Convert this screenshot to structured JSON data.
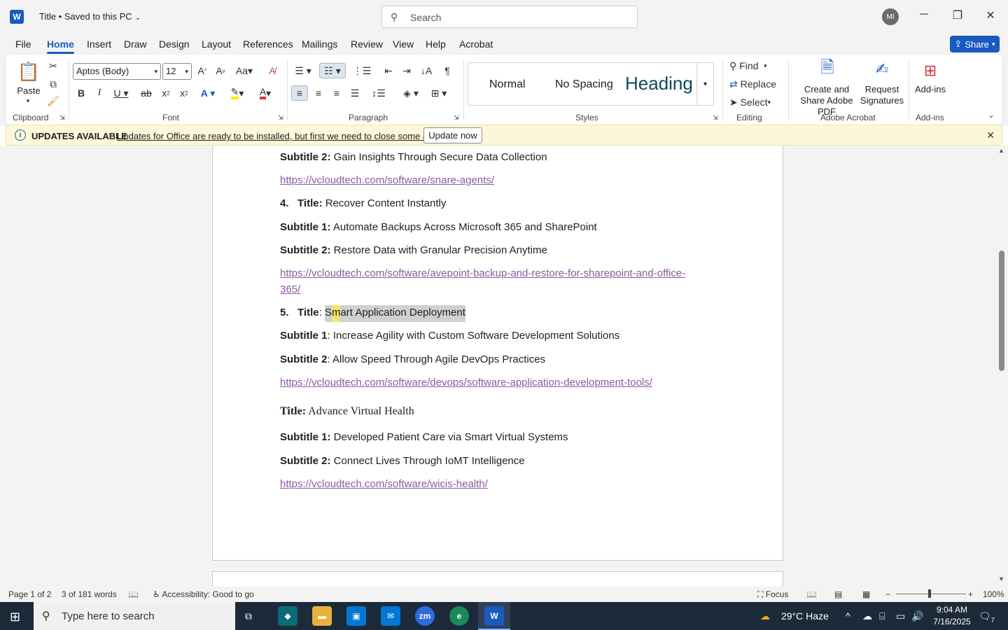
{
  "titlebar": {
    "title": "Title • Saved to this PC",
    "search_placeholder": "Search",
    "avatar_initials": "MI"
  },
  "menu": {
    "tabs": [
      "File",
      "Home",
      "Insert",
      "Draw",
      "Design",
      "Layout",
      "References",
      "Mailings",
      "Review",
      "View",
      "Help",
      "Acrobat"
    ],
    "active": "Home",
    "share_label": "Share"
  },
  "ribbon": {
    "clipboard": {
      "paste_label": "Paste",
      "group_label": "Clipboard"
    },
    "font": {
      "family": "Aptos (Body)",
      "size": "12",
      "group_label": "Font"
    },
    "paragraph": {
      "group_label": "Paragraph"
    },
    "styles": {
      "items": [
        "Normal",
        "No Spacing",
        "Heading"
      ],
      "group_label": "Styles"
    },
    "editing": {
      "find": "Find",
      "replace": "Replace",
      "select": "Select",
      "group_label": "Editing"
    },
    "acrobat": {
      "create_share": "Create and Share Adobe PDF",
      "request_sig": "Request Signatures",
      "group_label": "Adobe Acrobat"
    },
    "addins": {
      "label": "Add-ins",
      "group_label": "Add-ins"
    }
  },
  "update_bar": {
    "title": "UPDATES AVAILABLE",
    "message": "Updates for Office are ready to be installed, but first we need to close some apps.",
    "button": "Update now"
  },
  "document": {
    "lines": {
      "l1_label": "Subtitle 2:",
      "l1_text": " Gain Insights Through Secure Data Collection",
      "l2_link": "https://vcloudtech.com/software/snare-agents/",
      "l3_num": "4.",
      "l3_label": "Title:",
      "l3_text": " Recover Content Instantly",
      "l4_label": "Subtitle 1:",
      "l4_text": " Automate Backups Across Microsoft 365 and SharePoint",
      "l5_label": "Subtitle 2:",
      "l5_text": " Restore Data with Granular Precision Anytime",
      "l6_link_a": "https://vcloudtech.com/software/avepoint-backup-and-restore-for-sharepoint-and-office-",
      "l6_link_b": "365/",
      "l7_num": "5.",
      "l7_label": "Title",
      "l7_colon": ": ",
      "l7_sel_a": "S",
      "l7_sel_b": "m",
      "l7_sel_c": "art Application Deployment",
      "l8_label": "Subtitle 1",
      "l8_text": ": Increase Agility with Custom Software Development Solutions",
      "l9_label": "Subtitle 2",
      "l9_text": ": Allow Speed Through Agile DevOps Practices",
      "l10_link": "https://vcloudtech.com/software/devops/software-application-development-tools/",
      "l11_label": "Title:",
      "l11_text": " Advance Virtual Health",
      "l12_label": "Subtitle 1:",
      "l12_text": " Developed Patient Care via Smart Virtual Systems",
      "l13_label": "Subtitle 2:",
      "l13_text": " Connect Lives Through IoMT Intelligence",
      "l14_link": "https://vcloudtech.com/software/wicis-health/"
    }
  },
  "statusbar": {
    "page": "Page 1 of 2",
    "words": "3 of 181 words",
    "accessibility": "Accessibility: Good to go",
    "focus": "Focus",
    "zoom": "100%"
  },
  "taskbar": {
    "search_placeholder": "Type here to search",
    "weather": "29°C  Haze",
    "time": "9:04 AM",
    "date": "7/16/2025",
    "notifications": "7"
  },
  "colors": {
    "accent": "#185abd",
    "link": "#8a5a9e",
    "update_bg": "#fcf7d8"
  }
}
